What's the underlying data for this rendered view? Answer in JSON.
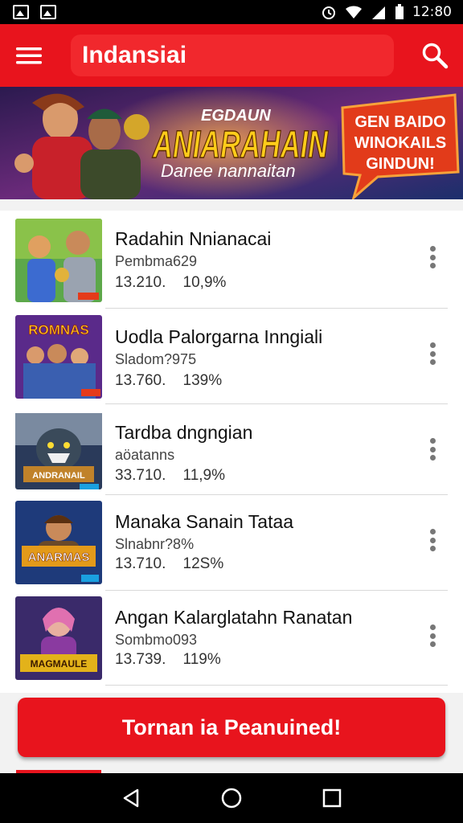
{
  "status_bar": {
    "time": "12:80"
  },
  "app_bar": {
    "title": "Indansiai",
    "menu_icon": "hamburger-menu-icon",
    "search_icon": "search-icon"
  },
  "banner": {
    "kicker": "EGDAUN",
    "headline": "ANIARAHAIN",
    "tagline": "Danee nannaitan",
    "badge": [
      "GEN BAIDO",
      "WINOKAILS",
      "GINDUN!"
    ]
  },
  "items": [
    {
      "title": "Radahin Nnianacai",
      "subtitle": "Pembma629",
      "stat1": "13.210.",
      "stat2": "10,9%",
      "thumb_text": ""
    },
    {
      "title": "Uodla Palorgarna Inngiali",
      "subtitle": "Sladom?975",
      "stat1": "13.760.",
      "stat2": "139%",
      "thumb_text": "ROMNAS"
    },
    {
      "title": "Tardba dngngian",
      "subtitle": "aöatanns",
      "stat1": "33.710.",
      "stat2": "11,9%",
      "thumb_text": "ANDRANAIL"
    },
    {
      "title": "Manaka Sanain Tataa",
      "subtitle": "Slnabnr?8%",
      "stat1": "13.710.",
      "stat2": "12S%",
      "thumb_text": "ANARMAS"
    },
    {
      "title": "Angan Kalarglatahn Ranatan",
      "subtitle": "Sombmo093",
      "stat1": "13.739.",
      "stat2": "119%",
      "thumb_text": "MAGMAULE"
    }
  ],
  "cta": {
    "label": "Tornan ia Peanuined!"
  },
  "colors": {
    "brand_red": "#e8141d"
  }
}
